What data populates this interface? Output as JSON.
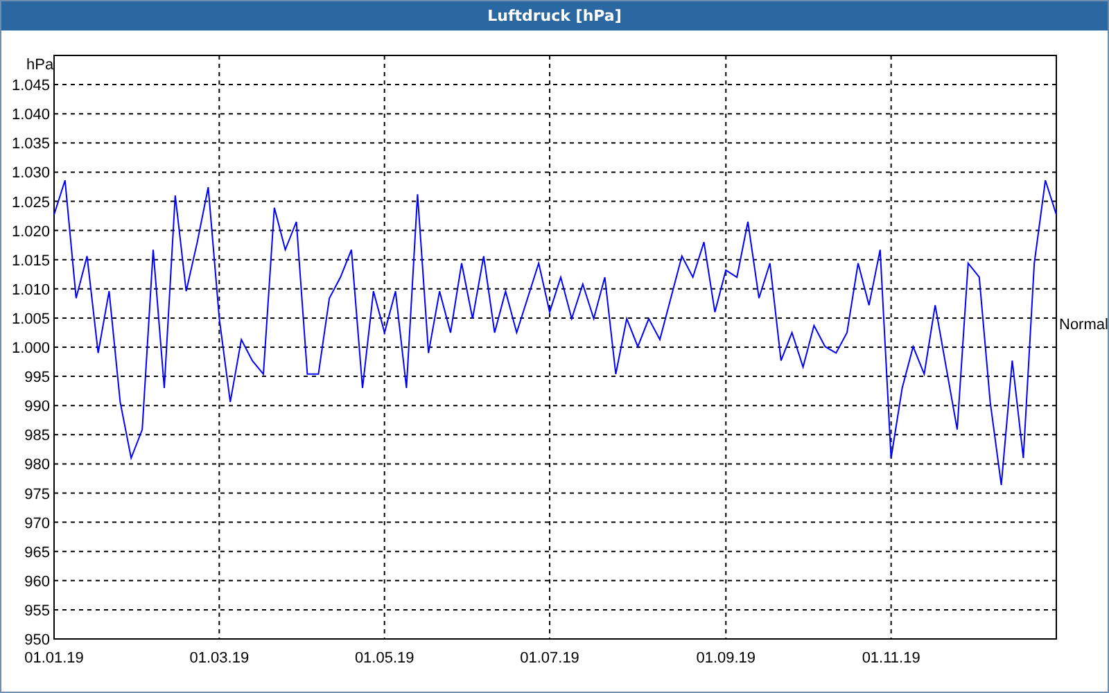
{
  "chart_data": {
    "type": "line",
    "title": "Luftdruck [hPa]",
    "ylabel": "hPa",
    "grid": true,
    "categories": [
      "01.01.19",
      null,
      null,
      null,
      null,
      null,
      null,
      null,
      null,
      null,
      null,
      null,
      null,
      null,
      null,
      "01.03.19",
      null,
      null,
      null,
      null,
      null,
      null,
      null,
      null,
      null,
      null,
      null,
      null,
      null,
      null,
      "01.05.19",
      null,
      null,
      null,
      null,
      null,
      null,
      null,
      null,
      null,
      null,
      null,
      null,
      null,
      null,
      "01.07.19",
      null,
      null,
      null,
      null,
      null,
      null,
      null,
      null,
      null,
      null,
      null,
      null,
      null,
      null,
      null,
      "01.09.19",
      null,
      null,
      null,
      null,
      null,
      null,
      null,
      null,
      null,
      null,
      null,
      null,
      null,
      null,
      "01.11.19",
      null,
      null,
      null,
      null,
      null,
      null,
      null,
      null,
      null,
      null,
      null,
      null,
      null,
      null,
      null
    ],
    "series": [
      {
        "color": "#0000ff",
        "values": [
          1022.7,
          1028.6,
          1008.4,
          1015.6,
          999,
          1009.6,
          990.6,
          981,
          985.9,
          1016.7,
          993,
          1026,
          1009.6,
          1018,
          1027.4,
          1004.9,
          990.6,
          1001.3,
          997.7,
          995.4,
          1023.9,
          1016.7,
          1021.5,
          995.4,
          995.4,
          1008.4,
          1012,
          1016.7,
          993,
          1009.6,
          1002.5,
          1009.6,
          993,
          1026.2,
          999,
          1009.6,
          1002.5,
          1014.4,
          1004.9,
          1015.6,
          1002.5,
          1009.6,
          1002.5,
          1008.4,
          1014.4,
          1006,
          1012,
          1004.9,
          1010.8,
          1004.9,
          1012,
          995.4,
          1004.9,
          1000.1,
          1004.9,
          1001.3,
          1008.4,
          1015.6,
          1012,
          1018,
          1006,
          1013.2,
          1012,
          1021.5,
          1008.4,
          1014.4,
          997.7,
          1002.5,
          996.6,
          1003.7,
          1000.1,
          999,
          1002.5,
          1014.4,
          1007.2,
          1016.7,
          981,
          993,
          1000.1,
          995.4,
          1007.2,
          996.6,
          985.9,
          1014.4,
          1012,
          990.6,
          976.4,
          997.7,
          981,
          1014.4,
          1028.6,
          1022.7
        ]
      }
    ],
    "ylim": [
      950,
      1050
    ],
    "yticks": [
      {
        "value": 950,
        "label": "950"
      },
      {
        "value": 955,
        "label": "955"
      },
      {
        "value": 960,
        "label": "960"
      },
      {
        "value": 965,
        "label": "965"
      },
      {
        "value": 970,
        "label": "970"
      },
      {
        "value": 975,
        "label": "975"
      },
      {
        "value": 980,
        "label": "980"
      },
      {
        "value": 985,
        "label": "985"
      },
      {
        "value": 990,
        "label": "990"
      },
      {
        "value": 995,
        "label": "995"
      },
      {
        "value": 1000,
        "label": "1.000"
      },
      {
        "value": 1005,
        "label": "1.005"
      },
      {
        "value": 1010,
        "label": "1.010"
      },
      {
        "value": 1015,
        "label": "1.015"
      },
      {
        "value": 1020,
        "label": "1.020"
      },
      {
        "value": 1025,
        "label": "1.025"
      },
      {
        "value": 1030,
        "label": "1.030"
      },
      {
        "value": 1035,
        "label": "1.035"
      },
      {
        "value": 1040,
        "label": "1.040"
      },
      {
        "value": 1045,
        "label": "1.045"
      }
    ],
    "annotations": [
      "Normal"
    ]
  }
}
